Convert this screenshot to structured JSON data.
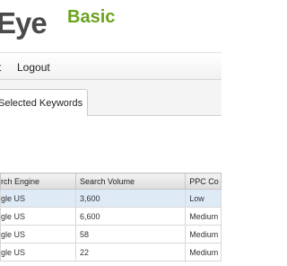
{
  "app": {
    "logo_main": "Eye",
    "logo_tier": "Basic",
    "brand_color": "#6aa31e"
  },
  "menu": {
    "items": [
      {
        "label": "t"
      },
      {
        "label": "Logout"
      }
    ]
  },
  "tabs": [
    {
      "label": "Selected Keywords",
      "active": true
    }
  ],
  "table": {
    "columns": [
      "rch Engine",
      "Search Volume",
      "PPC Co"
    ],
    "rows": [
      {
        "engine": "gle US",
        "volume": "3,600",
        "ppc": "Low"
      },
      {
        "engine": "gle US",
        "volume": "6,600",
        "ppc": "Medium"
      },
      {
        "engine": "gle US",
        "volume": "58",
        "ppc": "Medium"
      },
      {
        "engine": "gle US",
        "volume": "22",
        "ppc": "Medium"
      }
    ]
  }
}
